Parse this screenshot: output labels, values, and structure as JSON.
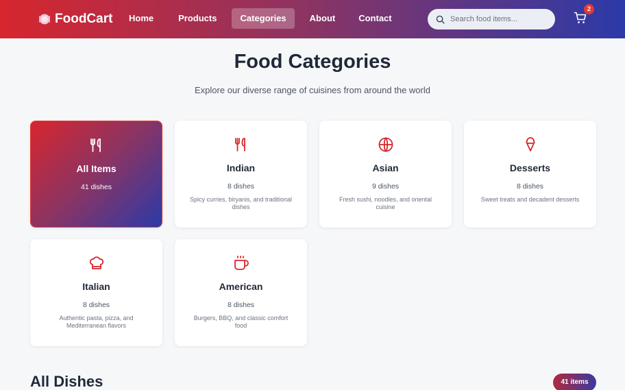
{
  "nav": {
    "brand": "FoodCart",
    "links": [
      "Home",
      "Products",
      "Categories",
      "About",
      "Contact"
    ],
    "active_link": "Categories",
    "search_placeholder": "Search food items...",
    "cart_count": "2"
  },
  "header": {
    "title": "Food Categories",
    "subtitle": "Explore our diverse range of cuisines from around the world"
  },
  "categories": [
    {
      "name": "All Items",
      "count": "41 dishes",
      "desc": "",
      "icon": "utensils-icon",
      "active": true
    },
    {
      "name": "Indian",
      "count": "8 dishes",
      "desc": "Spicy curries, biryanis, and traditional dishes",
      "icon": "utensils-icon"
    },
    {
      "name": "Asian",
      "count": "9 dishes",
      "desc": "Fresh sushi, noodles, and oriental cuisine",
      "icon": "globe-icon"
    },
    {
      "name": "Desserts",
      "count": "8 dishes",
      "desc": "Sweet treats and decadent desserts",
      "icon": "ice-cream-icon"
    },
    {
      "name": "Italian",
      "count": "8 dishes",
      "desc": "Authentic pasta, pizza, and Mediterranean flavors",
      "icon": "chef-hat-icon"
    },
    {
      "name": "American",
      "count": "8 dishes",
      "desc": "Burgers, BBQ, and classic comfort food",
      "icon": "coffee-cup-icon"
    }
  ],
  "section": {
    "title": "All Dishes",
    "badge": "41 items"
  },
  "colors": {
    "accent_red": "#e53935",
    "gradient_start": "#d7262e",
    "gradient_end": "#2b3aa8"
  }
}
